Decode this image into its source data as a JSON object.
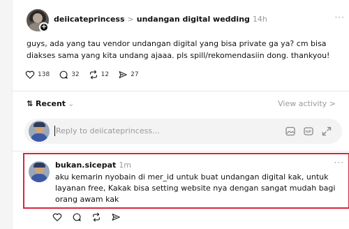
{
  "post": {
    "username": "deiicateprincess",
    "separator": ">",
    "topic": "undangan digital wedding",
    "time": "14h",
    "more": "···",
    "text": "guys, ada yang tau vendor undangan digital yang bisa private ga ya? cm bisa diakses sama yang kita undang ajaaa. pls spill/rekomendasiin dong. thankyou!",
    "stats": {
      "likes": "138",
      "replies": "32",
      "reposts": "12",
      "shares": "27"
    }
  },
  "sort": {
    "label": "⇅ Recent",
    "chevron": "⌄",
    "view_activity": "View activity >"
  },
  "reply": {
    "placeholder": "Reply to deiicateprincess..."
  },
  "comment": {
    "username": "bukan.sicepat",
    "time": "1m",
    "more": "···",
    "text": "aku kemarin nyobain di mer_id untuk buat undangan digital kak, untuk layanan free, Kakak bisa setting website nya dengan sangat mudah bagi orang awam kak"
  },
  "colors": {
    "highlight_border": "#d7263d",
    "muted": "#999999"
  },
  "icons": [
    "plus-badge-icon",
    "heart-icon",
    "comment-icon",
    "repost-icon",
    "share-icon",
    "image-icon",
    "gif-icon",
    "expand-icon"
  ]
}
